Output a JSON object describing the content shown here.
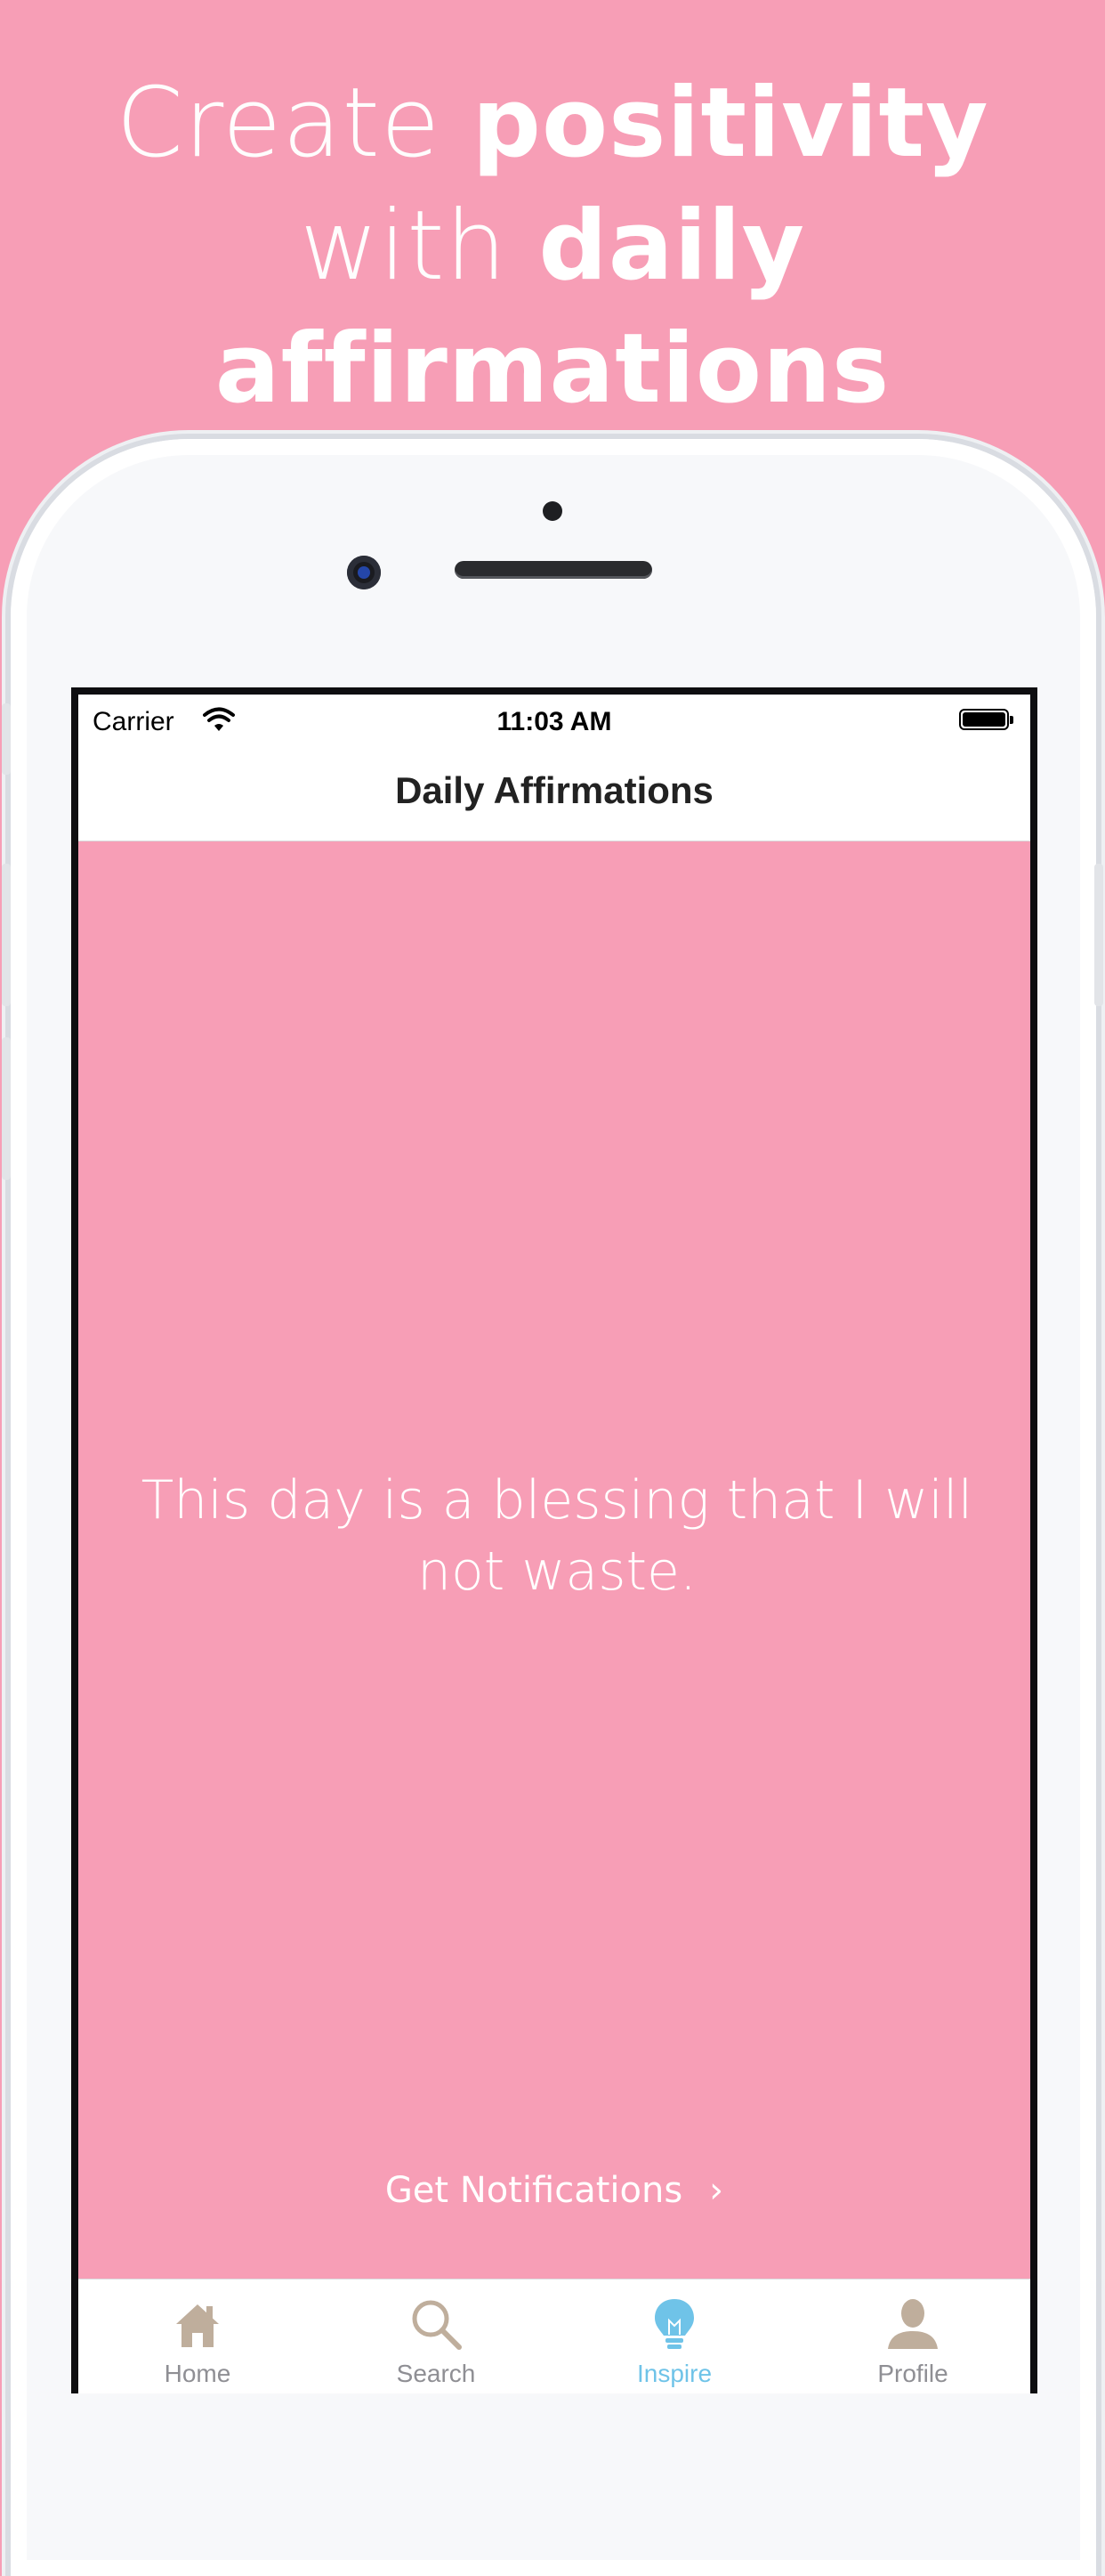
{
  "headline": {
    "line1_thin": "Create",
    "line1_bold": "positivity",
    "line2_thin": "with",
    "line2_bold": "daily",
    "line3_bold": "affirmations"
  },
  "status_bar": {
    "carrier": "Carrier",
    "time": "11:03 AM"
  },
  "nav": {
    "title": "Daily Affirmations"
  },
  "main": {
    "affirmation": "This day is a blessing that I will not waste.",
    "notifications_label": "Get Notifications",
    "notifications_chevron": "›"
  },
  "tabs": [
    {
      "label": "Home",
      "icon": "home-icon",
      "active": false
    },
    {
      "label": "Search",
      "icon": "search-icon",
      "active": false
    },
    {
      "label": "Inspire",
      "icon": "lightbulb-icon",
      "active": true
    },
    {
      "label": "Profile",
      "icon": "profile-icon",
      "active": false
    }
  ],
  "colors": {
    "background": "#F79EB6",
    "accent": "#6FC3E8",
    "tab_inactive": "#BFAE9C"
  }
}
